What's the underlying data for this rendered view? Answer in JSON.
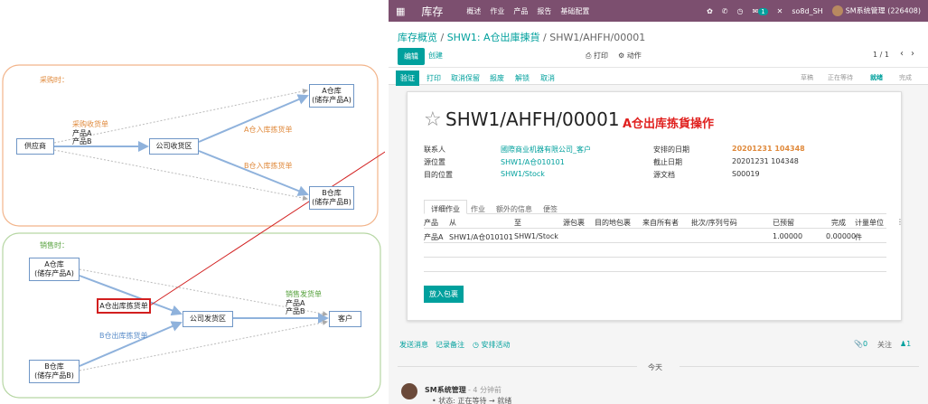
{
  "diagram": {
    "purchase_title": "采购时：",
    "sales_title": "销售时：",
    "nodes": {
      "supplier": "供应商",
      "receiving": "公司收货区",
      "wh_a_top_1": "A仓库",
      "wh_a_top_2": "(储存产品A)",
      "wh_b_top_1": "B仓库",
      "wh_b_top_2": "(储存产品B)",
      "wh_a_bot_1": "A仓库",
      "wh_a_bot_2": "(储存产品A)",
      "wh_b_bot_1": "B仓库",
      "wh_b_bot_2": "(储存产品B)",
      "a_pick": "A仓出库拣货单",
      "shipping": "公司发货区",
      "customer": "客户"
    },
    "labels": {
      "purchase_receipt": "采购收货单",
      "product_a": "产品A",
      "product_b": "产品B",
      "a_putaway": "A仓入库拣货单",
      "b_putaway": "B仓入库拣货单",
      "sales_delivery": "销售发货单",
      "product_a2": "产品A",
      "product_b2": "产品B",
      "b_pick": "B仓出库拣货单"
    }
  },
  "app": {
    "brand": "库存",
    "menu": [
      "概述",
      "作业",
      "产品",
      "报告",
      "基础配置"
    ],
    "chat_badge": "1",
    "company": "so8d_SH",
    "user": "SM系统管理 (226408)",
    "breadcrumb": {
      "first": "库存概览",
      "sep1": " / ",
      "second": "SHW1: A仓出庫揀貨",
      "sep2": " / ",
      "current": "SHW1/AHFH/00001"
    },
    "edit": "编辑",
    "create": "创建",
    "print": "打印",
    "action": "动作",
    "pager": "1 / 1",
    "validate": "验证",
    "status_buttons": [
      "打印",
      "取消保留",
      "报废",
      "解锁",
      "取消"
    ],
    "stages": [
      "草稿",
      "正在等待",
      "就绪",
      "完成"
    ],
    "title": "SHW1/AHFH/00001",
    "annotation": "A仓出库拣貨操作",
    "fields": {
      "contact_label": "联系人",
      "contact_value": "國際商业机器有限公司_客户",
      "src_label": "源位置",
      "src_value": "SHW1/A仓010101",
      "dest_label": "目的位置",
      "dest_value": "SHW1/Stock",
      "scheduled_label": "安排的日期",
      "scheduled_value": "20201231 104348",
      "deadline_label": "截止日期",
      "deadline_value": "20201231 104348",
      "source_doc_label": "源文档",
      "source_doc_value": "S00019"
    },
    "tabs": [
      "详细作业",
      "作业",
      "额外的信息",
      "便签"
    ],
    "table": {
      "headers": [
        "产品",
        "从",
        "至",
        "源包裹",
        "目的地包裹",
        "来自所有者",
        "批次/序列号码",
        "已预留",
        "完成",
        "计量单位"
      ],
      "row": [
        "产品A",
        "SHW1/A仓010101",
        "SHW1/Stock",
        "",
        "",
        "",
        "",
        "1.00000",
        "0.00000",
        "件"
      ]
    },
    "put_in_pack": "放入包裹",
    "chatter": {
      "send_message": "发送消息",
      "log_note": "记录备注",
      "schedule_activity": "安排活动",
      "attachments": "0",
      "follow": "关注",
      "followers": "1",
      "today": "今天",
      "author": "SM系统管理",
      "time": "- 4 分钟前",
      "change": "状态: 正在等待 → 就绪"
    }
  }
}
